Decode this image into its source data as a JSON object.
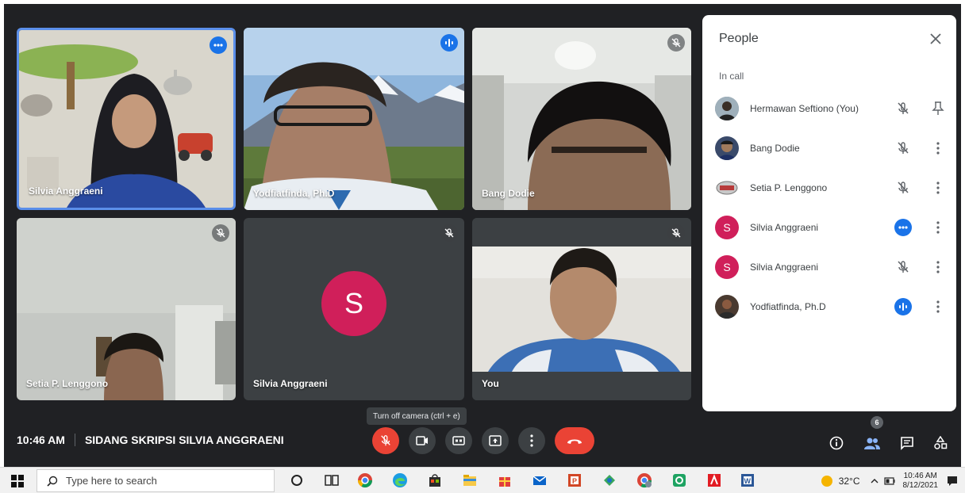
{
  "tiles": [
    {
      "name": "Silvia Anggraeni",
      "status_icon": "more-dots-icon"
    },
    {
      "name": "Yodfiatfinda, Ph.D",
      "status_icon": "audio-level-icon"
    },
    {
      "name": "Bang Dodie",
      "status_icon": "mic-off-icon"
    },
    {
      "name": "Setia P. Lenggono",
      "status_icon": "mic-off-icon"
    },
    {
      "name": "Silvia Anggraeni",
      "avatar_letter": "S",
      "status_icon": "mic-off-icon"
    },
    {
      "name": "You",
      "status_icon": "mic-off-icon"
    }
  ],
  "people_panel": {
    "title": "People",
    "section": "In call",
    "participants": [
      {
        "name": "Hermawan Seftiono (You)",
        "status": "mic-off-icon",
        "action": "pin-icon"
      },
      {
        "name": "Bang Dodie",
        "status": "mic-off-icon",
        "action": "more-vert-icon"
      },
      {
        "name": "Setia P. Lenggono",
        "status": "mic-off-icon",
        "action": "more-vert-icon"
      },
      {
        "name": "Silvia Anggraeni",
        "avatar_letter": "S",
        "status": "more-dots-icon",
        "action": "more-vert-icon"
      },
      {
        "name": "Silvia Anggraeni",
        "avatar_letter": "S",
        "status": "mic-off-icon",
        "action": "more-vert-icon"
      },
      {
        "name": "Yodfiatfinda, Ph.D",
        "status": "audio-level-icon",
        "action": "more-vert-icon"
      }
    ]
  },
  "meeting": {
    "time": "10:46 AM",
    "title": "SIDANG SKRIPSI SILVIA ANGGRAENI",
    "tooltip": "Turn off camera (ctrl + e)",
    "participant_count": "6"
  },
  "taskbar": {
    "search_placeholder": "Type here to search",
    "temperature": "32°C",
    "time": "10:46 AM",
    "date": "8/12/2021"
  },
  "colors": {
    "meet_bg": "#202124",
    "tile_bg": "#3c4043",
    "accent_blue": "#1a73e8",
    "danger_red": "#ea4335",
    "avatar_pink": "#d01f5a"
  }
}
